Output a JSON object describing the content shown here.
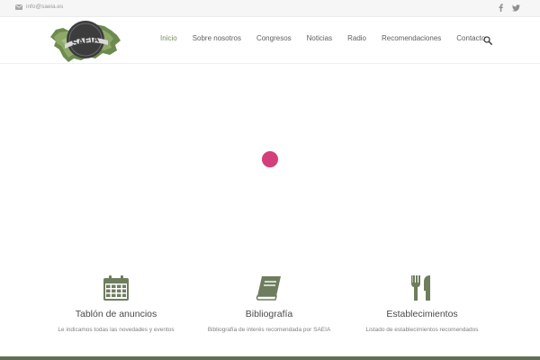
{
  "topbar": {
    "email": "info@saeia.es",
    "social": [
      "facebook-icon",
      "twitter-icon"
    ]
  },
  "header": {
    "logo_text": "SAEIA",
    "nav": [
      {
        "label": "Inicio",
        "active": true
      },
      {
        "label": "Sobre nosotros",
        "active": false
      },
      {
        "label": "Congresos",
        "active": false
      },
      {
        "label": "Noticias",
        "active": false
      },
      {
        "label": "Radio",
        "active": false
      },
      {
        "label": "Recomendaciones",
        "active": false
      },
      {
        "label": "Contacto",
        "active": false
      }
    ],
    "search_icon": "search-icon"
  },
  "colors": {
    "accent": "#7a8a5c",
    "loader": "#d23f7b",
    "footer": "#5f7052",
    "icon": "#6f7d5e"
  },
  "features": [
    {
      "icon": "calendar-icon",
      "title": "Tablón de anuncios",
      "desc": "Le indicamos todas las novedades y eventos"
    },
    {
      "icon": "book-icon",
      "title": "Bibliografía",
      "desc": "Bibliografía de interés recomendada por SAEIA"
    },
    {
      "icon": "cutlery-icon",
      "title": "Establecimientos",
      "desc": "Listado de establecimientos recomendados"
    }
  ]
}
